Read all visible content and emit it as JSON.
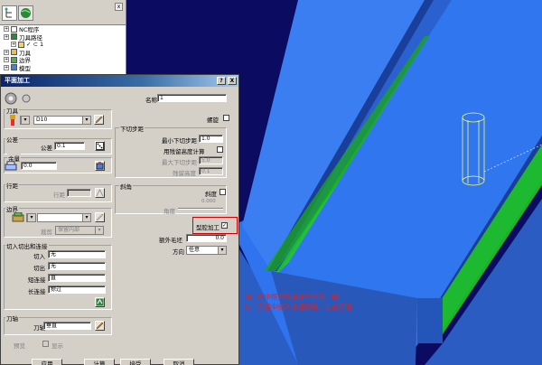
{
  "explorer": {
    "close": "x",
    "tree": [
      {
        "text": "NC程序",
        "indent": 0
      },
      {
        "text": "刀具路径",
        "indent": 0
      },
      {
        "text": "✓ ⊂ 1",
        "indent": 1
      },
      {
        "text": "刀具",
        "indent": 0
      },
      {
        "text": "边界",
        "indent": 0
      },
      {
        "text": "模型",
        "indent": 0
      }
    ]
  },
  "dialog": {
    "title": "平面加工",
    "help_btn": "?",
    "close_btn": "X",
    "name_label": "名称",
    "name_value": "1",
    "tool_group": "刀具",
    "tool_value": "D10",
    "contact_label": "螺旋",
    "tolerance_group": "公差",
    "tolerance_label": "公差",
    "tolerance_value": "0.1",
    "allowance_group": "余量",
    "allowance_value": "0.0",
    "stepover_group": "行距",
    "stepover_label": "行距",
    "boundary_group": "边界",
    "boundary_sub_label": "裁剪",
    "boundary_sub_value": "保留内部",
    "leads_group": "切入切出和连接",
    "lead_in_label": "切入",
    "lead_in_value": "无",
    "lead_out_label": "切出",
    "lead_out_value": "无",
    "short_link_label": "短连接",
    "short_link_value": "直",
    "long_link_label": "长连接",
    "long_link_value": "掠过",
    "stepdown_group": "下切步距",
    "min_stepdown_label": "最小下切步距",
    "min_stepdown_value": "1.0",
    "residual_label": "用残留高度计算",
    "max_stepdown_label": "最大下切步距",
    "max_stepdown_value": "5.0",
    "cusp_label": "残留高度",
    "cusp_value": "0.1",
    "angle_group": "斜角",
    "taper_label": "斜度",
    "angle_value": "0.000",
    "angle_sub_label": "角度",
    "pocket_label": "型腔加工",
    "pocket_checked": "✓",
    "extra_label": "额外毛坯",
    "extra_value": "0.0",
    "direction_label": "方向",
    "direction_value": "任意",
    "axis_group": "刀轴",
    "axis_label": "刀轴",
    "axis_value": "垂直",
    "preview_label": "预览",
    "display_label": "显示",
    "buttons": [
      "应用",
      "计算",
      "接受",
      "取消"
    ]
  },
  "annotation": {
    "line1": "使用图中框选项设置型腔加工即",
    "line2": "在一刀路中依次多层切削，生成刀路"
  },
  "colors": {
    "background": "#0b0b62",
    "model": "#2f6fe8",
    "toolpath": "#1fcf1f",
    "highlight": "#d00000",
    "annotation": "#e02020"
  }
}
